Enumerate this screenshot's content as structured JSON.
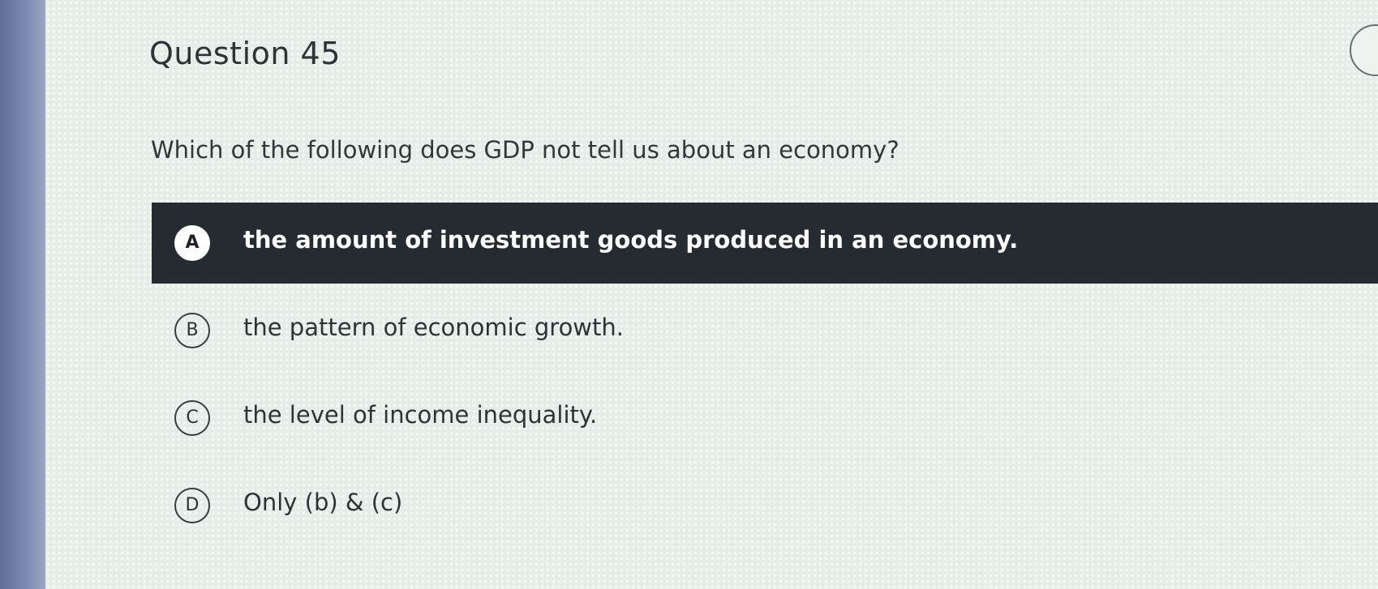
{
  "question": {
    "title": "Question 45",
    "prompt": "Which of the following does GDP not tell us about an economy?"
  },
  "options": [
    {
      "letter": "A",
      "text": "the amount of investment goods produced in an economy.",
      "selected": true
    },
    {
      "letter": "B",
      "text": "the pattern of economic growth.",
      "selected": false
    },
    {
      "letter": "C",
      "text": "the level of income inequality.",
      "selected": false
    },
    {
      "letter": "D",
      "text": "Only (b) & (c)",
      "selected": false
    }
  ],
  "colors": {
    "selected_bg": "#262a31",
    "page_bg": "#e4ede8",
    "side_bar": "#7d8cb3"
  }
}
